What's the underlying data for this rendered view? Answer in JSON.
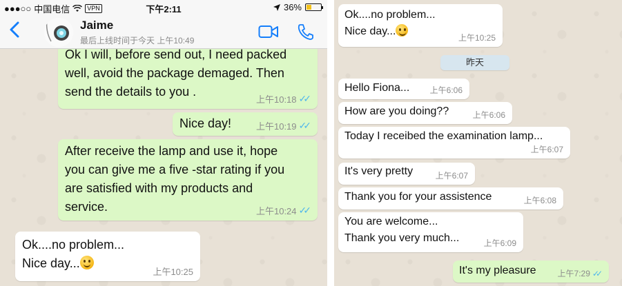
{
  "left_screen": {
    "status_bar": {
      "signal": "●●●○○",
      "carrier": "中国电信",
      "wifi": "wifi-icon",
      "vpn": "VPN",
      "time": "下午2:11",
      "location_arrow": "location-arrow-icon",
      "battery_percent": "36%",
      "battery_level": 0.36,
      "battery_color": "#f3c21b"
    },
    "header": {
      "contact_name": "Jaime",
      "last_seen": "最后上线时间于今天 上午10:49"
    },
    "messages": [
      {
        "direction": "outgoing",
        "text": "Ok I will, before send out, I need packed\nwell, avoid the package demaged. Then\nsend the details to you .",
        "time": "上午10:18",
        "read": true
      },
      {
        "direction": "outgoing",
        "text": "Nice day!",
        "time": "上午10:19",
        "read": true
      },
      {
        "direction": "outgoing",
        "text": "After receive the lamp and use it, hope\nyou can give me a five -star rating if you\nare satisfied with my products and\nservice.",
        "time": "上午10:24",
        "read": true
      },
      {
        "direction": "incoming",
        "text": "Ok....no problem...\nNice day...",
        "time": "上午10:25",
        "emoji": "smiling-face-emoji"
      }
    ]
  },
  "right_screen": {
    "date_separator": "昨天",
    "messages": [
      {
        "direction": "incoming",
        "text": "Ok....no problem...\nNice day...",
        "time": "上午10:25",
        "emoji": "smiling-face-emoji"
      },
      {
        "direction": "incoming",
        "text": "Hello Fiona...",
        "time": "上午6:06"
      },
      {
        "direction": "incoming",
        "text": "How are you doing??",
        "time": "上午6:06"
      },
      {
        "direction": "incoming",
        "text": "Today I receibed the examination lamp...",
        "time": "上午6:07"
      },
      {
        "direction": "incoming",
        "text": "It's very pretty",
        "time": "上午6:07"
      },
      {
        "direction": "incoming",
        "text": "Thank you for your assistence",
        "time": "上午6:08"
      },
      {
        "direction": "incoming",
        "text": "You are welcome...\nThank you very much...",
        "time": "上午6:09"
      },
      {
        "direction": "outgoing",
        "text": "It's my pleasure",
        "time": "上午7:29",
        "read": true
      }
    ]
  },
  "colors": {
    "outgoing_bubble": "#dcf8c6",
    "incoming_bubble": "#ffffff",
    "chat_background": "#e8e1d6",
    "ios_blue": "#147efb",
    "read_ticks": "#4fb6ec"
  }
}
